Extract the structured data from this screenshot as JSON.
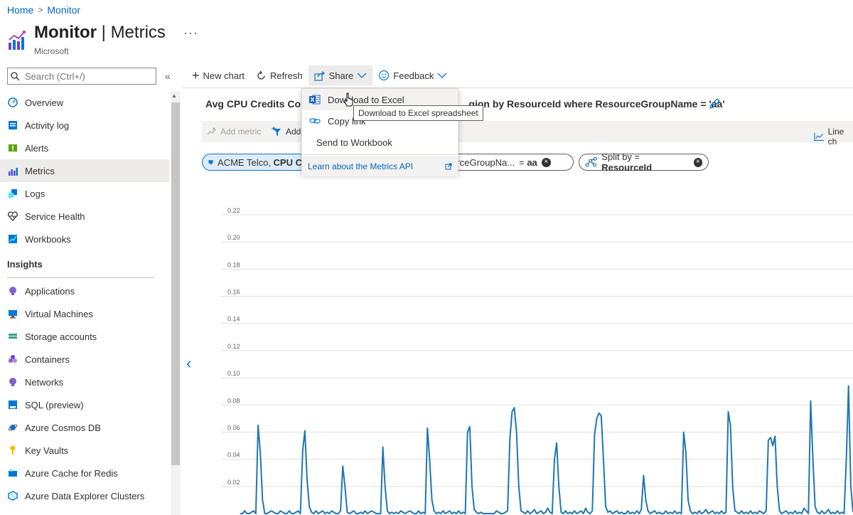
{
  "breadcrumb": {
    "home": "Home",
    "current": "Monitor"
  },
  "header": {
    "title_main": "Monitor",
    "title_sep": " | ",
    "title_sub": "Metrics",
    "publisher": "Microsoft",
    "more": "···"
  },
  "sidebar": {
    "search_placeholder": "Search (Ctrl+/)",
    "collapse_icon": "double-chevron-left-icon",
    "items": [
      {
        "label": "Overview",
        "icon": "overview-icon",
        "color": "#0078d4"
      },
      {
        "label": "Activity log",
        "icon": "activity-log-icon",
        "color": "#0078d4"
      },
      {
        "label": "Alerts",
        "icon": "alerts-icon",
        "color": "#57a300"
      },
      {
        "label": "Metrics",
        "icon": "metrics-icon",
        "color": "#773adc",
        "selected": true
      },
      {
        "label": "Logs",
        "icon": "logs-icon",
        "color": "#0078d4"
      },
      {
        "label": "Service Health",
        "icon": "service-health-icon",
        "color": "#323130"
      },
      {
        "label": "Workbooks",
        "icon": "workbooks-icon",
        "color": "#0078d4"
      }
    ],
    "insights_heading": "Insights",
    "insights": [
      {
        "label": "Applications",
        "icon": "applications-icon",
        "color": "#8661c5"
      },
      {
        "label": "Virtual Machines",
        "icon": "virtual-machines-icon",
        "color": "#0078d4"
      },
      {
        "label": "Storage accounts",
        "icon": "storage-accounts-icon",
        "color": "#3d9a8b"
      },
      {
        "label": "Containers",
        "icon": "containers-icon",
        "color": "#8661c5"
      },
      {
        "label": "Networks",
        "icon": "networks-icon",
        "color": "#8661c5"
      },
      {
        "label": "SQL (preview)",
        "icon": "sql-icon",
        "color": "#0078d4"
      },
      {
        "label": "Azure Cosmos DB",
        "icon": "cosmos-db-icon",
        "color": "#0078d4"
      },
      {
        "label": "Key Vaults",
        "icon": "key-vaults-icon",
        "color": "#ffb900"
      },
      {
        "label": "Azure Cache for Redis",
        "icon": "redis-icon",
        "color": "#0078d4"
      },
      {
        "label": "Azure Data Explorer Clusters",
        "icon": "data-explorer-icon",
        "color": "#0078d4"
      }
    ]
  },
  "toolbar": {
    "new_chart": "New chart",
    "refresh": "Refresh",
    "share": "Share",
    "feedback": "Feedback"
  },
  "chart": {
    "title_left": "Avg CPU Credits Cons",
    "title_right": "gion by ResourceId where ResourceGroupName = 'aa'",
    "add_metric": "Add metric",
    "add_filter": "Add",
    "line_chart": "Line ch"
  },
  "pills": {
    "scope_normal": "ACME Telco, ",
    "scope_bold": "CPU C",
    "filter_name": "ourceGroupNa...",
    "filter_op": "= ",
    "filter_value": "aa",
    "split_label": "Split by = ",
    "split_value": "ResourceId"
  },
  "share_menu": {
    "download_excel": "Download to Excel",
    "copy_link": "Copy link",
    "send_workbook": "Send to Workbook",
    "learn_api": "Learn about the Metrics API",
    "tooltip": "Download to Excel spreadsheet"
  },
  "chart_data": {
    "type": "line",
    "title": "",
    "xlabel": "",
    "ylabel": "",
    "ylim": [
      0,
      0.22
    ],
    "yticks": [
      "0.22",
      "0.20",
      "0.18",
      "0.16",
      "0.14",
      "0.12",
      "0.10",
      "0.08",
      "0.06",
      "0.04",
      "0.02"
    ],
    "grid": true,
    "color": "#1f77b4",
    "series": [
      {
        "values": [
          0.0,
          0.0,
          0.002,
          0.0,
          0.0,
          0.001,
          0.002,
          0.0,
          0.065,
          0.045,
          0.01,
          0.0,
          0.0,
          0.001,
          0.002,
          0.001,
          0.0,
          0.0,
          0.002,
          0.001,
          0.0,
          0.0,
          0.002,
          0.0,
          0.0,
          0.001,
          0.002,
          0.0,
          0.046,
          0.061,
          0.025,
          0.005,
          0.001,
          0.0,
          0.002,
          0.0,
          0.001,
          0.002,
          0.0,
          0.001,
          0.0,
          0.002,
          0.001,
          0.0,
          0.0,
          0.002,
          0.035,
          0.02,
          0.001,
          0.0,
          0.001,
          0.002,
          0.0,
          0.0,
          0.001,
          0.0,
          0.002,
          0.0,
          0.001,
          0.002,
          0.001,
          0.0,
          0.0,
          0.0,
          0.049,
          0.02,
          0.002,
          0.0,
          0.001,
          0.0,
          0.001,
          0.0,
          0.002,
          0.001,
          0.0,
          0.001,
          0.002,
          0.001,
          0.0,
          0.0,
          0.002,
          0.0,
          0.001,
          0.0,
          0.063,
          0.04,
          0.01,
          0.002,
          0.0,
          0.001,
          0.0,
          0.002,
          0.0,
          0.001,
          0.002,
          0.0,
          0.001,
          0.0,
          0.002,
          0.0,
          0.001,
          0.0,
          0.06,
          0.064,
          0.02,
          0.003,
          0.001,
          0.0,
          0.001,
          0.0,
          0.0,
          0.0,
          0.0,
          0.0,
          0.0,
          0.002,
          0.001,
          0.0,
          0.0,
          0.001,
          0.002,
          0.055,
          0.075,
          0.078,
          0.06,
          0.02,
          0.002,
          0.001,
          0.0,
          0.002,
          0.0,
          0.001,
          0.003,
          0.0,
          0.001,
          0.002,
          0.0,
          0.001,
          0.004,
          0.001,
          0.0,
          0.04,
          0.052,
          0.02,
          0.001,
          0.0,
          0.002,
          0.0,
          0.001,
          0.0,
          0.002,
          0.0,
          0.001,
          0.002,
          0.0,
          0.004,
          0.001,
          0.0,
          0.002,
          0.058,
          0.07,
          0.074,
          0.072,
          0.04,
          0.005,
          0.001,
          0.002,
          0.0,
          0.001,
          0.002,
          0.0,
          0.001,
          0.0,
          0.0,
          0.002,
          0.0,
          0.001,
          0.0,
          0.002,
          0.0,
          0.003,
          0.028,
          0.01,
          0.002,
          0.0,
          0.001,
          0.002,
          0.0,
          0.001,
          0.0,
          0.0,
          0.002,
          0.0,
          0.001,
          0.0,
          0.002,
          0.0,
          0.001,
          0.0,
          0.06,
          0.045,
          0.01,
          0.002,
          0.0,
          0.001,
          0.0,
          0.002,
          0.0,
          0.001,
          0.003,
          0.0,
          0.001,
          0.002,
          0.0,
          0.001,
          0.0,
          0.002,
          0.0,
          0.001,
          0.075,
          0.065,
          0.02,
          0.002,
          0.001,
          0.0,
          0.002,
          0.0,
          0.001,
          0.0,
          0.002,
          0.0,
          0.001,
          0.0,
          0.002,
          0.001,
          0.0,
          0.002,
          0.054,
          0.056,
          0.05,
          0.057,
          0.02,
          0.002,
          0.0,
          0.001,
          0.002,
          0.0,
          0.001,
          0.0,
          0.002,
          0.0,
          0.001,
          0.0,
          0.004,
          0.002,
          0.0,
          0.083,
          0.04,
          0.005,
          0.001,
          0.0,
          0.002,
          0.0,
          0.001,
          0.003,
          0.0,
          0.001,
          0.0,
          0.002,
          0.0,
          0.001,
          0.0,
          0.04,
          0.094,
          0.02,
          0.001
        ]
      }
    ]
  }
}
